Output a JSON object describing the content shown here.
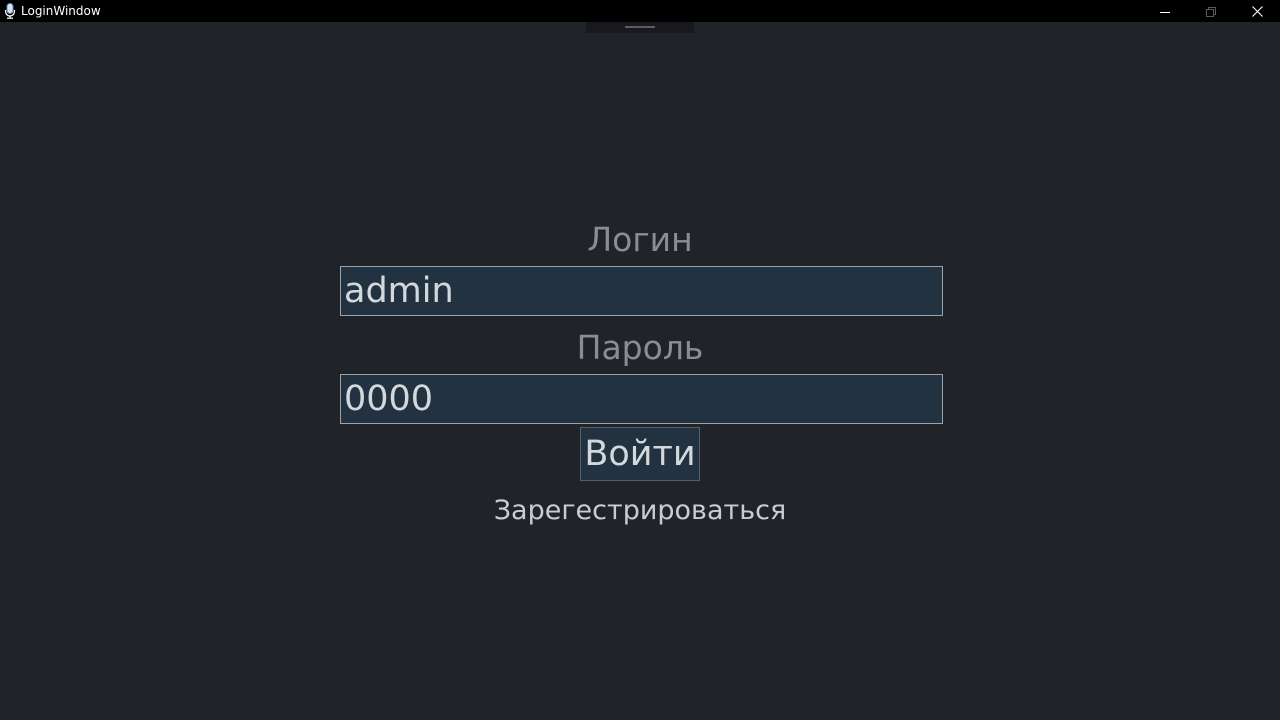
{
  "window": {
    "title": "LoginWindow",
    "icons": {
      "app": "microphone-app-icon",
      "minimize": "minimize-icon",
      "maximize": "maximize-icon",
      "close": "close-icon"
    }
  },
  "form": {
    "login_label": "Логин",
    "login_value": "admin",
    "password_label": "Пароль",
    "password_value": "0000",
    "submit_label": "Войти",
    "register_label": "Зарегестрироваться"
  },
  "colors": {
    "background": "#202328",
    "titlebar": "#000000",
    "field_background": "#233240",
    "label_text": "#8a8d92",
    "field_text": "#d3d8dc"
  }
}
